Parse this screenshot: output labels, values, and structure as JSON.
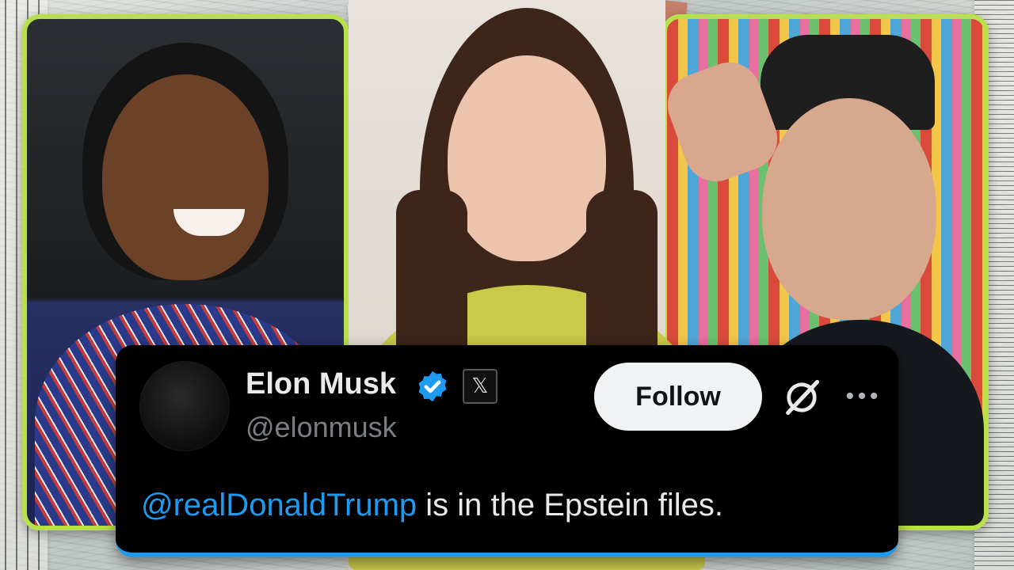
{
  "tweet": {
    "display_name": "Elon Musk",
    "handle": "@elonmusk",
    "follow_label": "Follow",
    "text_mention": "@realDonaldTrump",
    "text_rest": " is in the Epstein files.",
    "verified_icon": "verified-badge-icon",
    "x_icon_glyph": "𝕏"
  },
  "colors": {
    "accent_border": "#b8e04a",
    "mention_blue": "#1d9bf0",
    "tweet_bg": "#000000"
  }
}
